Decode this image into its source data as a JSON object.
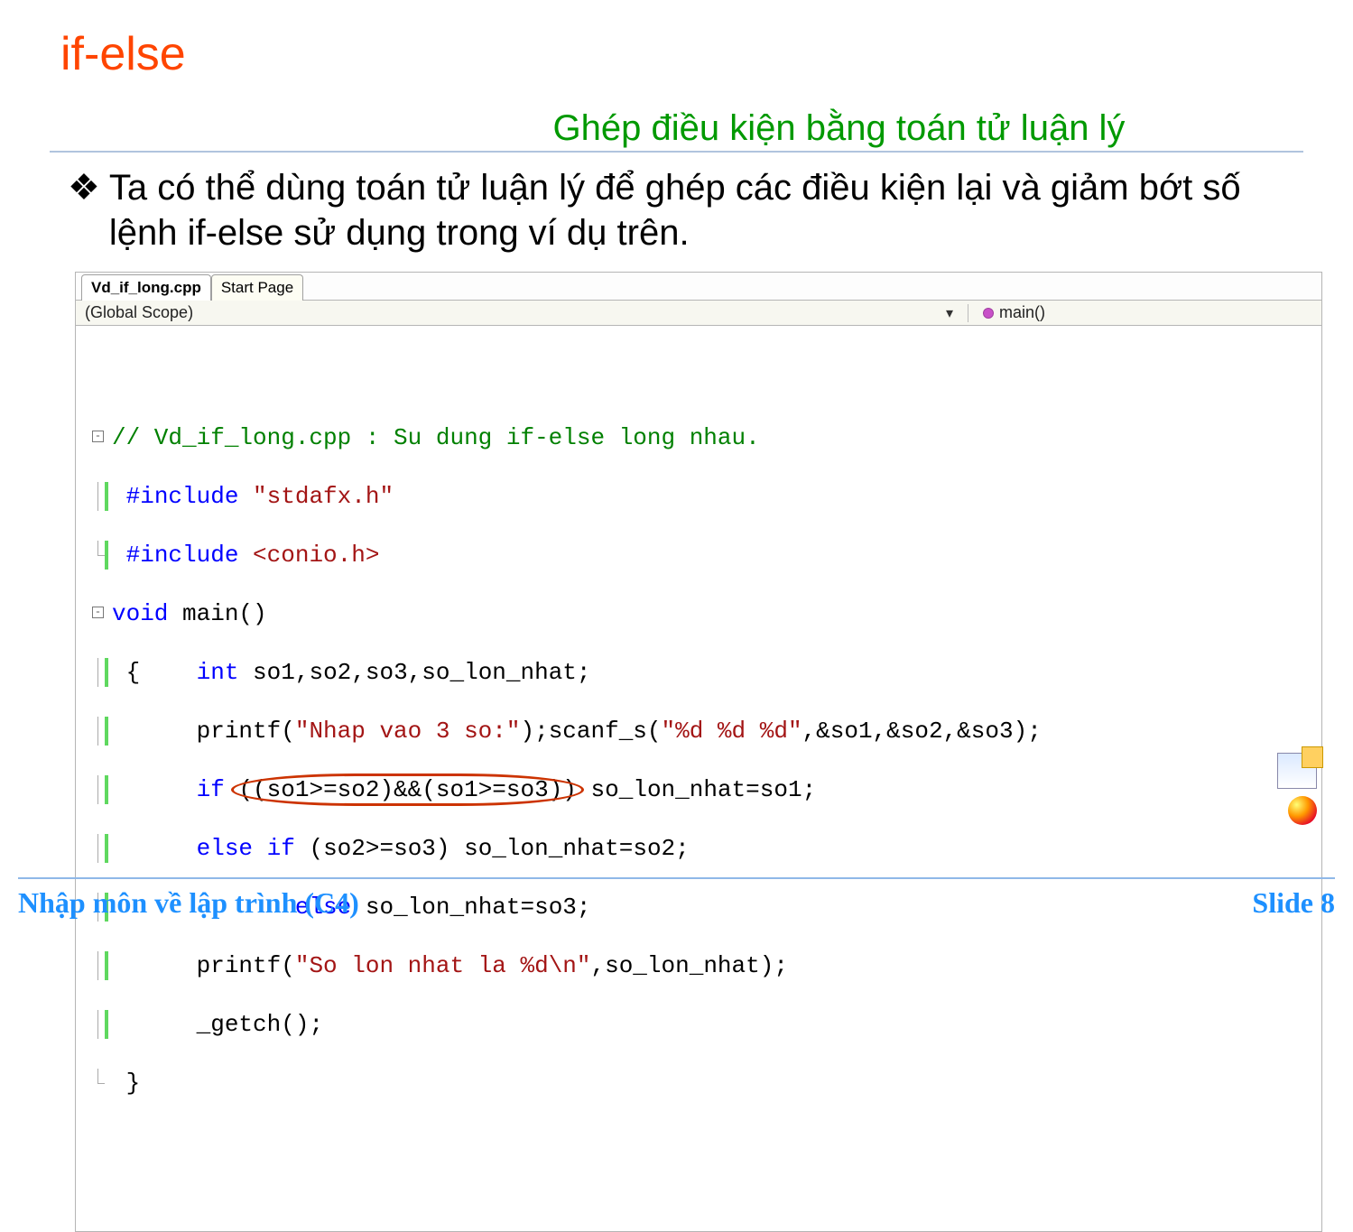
{
  "title": "if-else",
  "subtitle": "Ghép điều kiện bằng toán tử luận lý",
  "bullet_text": "Ta có thể dùng toán tử luận lý để ghép các điều kiện lại và giảm bớt số lệnh if-else sử dụng trong ví dụ trên.",
  "ide": {
    "tabs": {
      "active": "Vd_if_long.cpp",
      "inactive": "Start Page"
    },
    "scope_left": "(Global Scope)",
    "scope_right": "main()",
    "code": {
      "l1_comment": "// Vd_if_long.cpp : Su dung if-else long nhau.",
      "l2_a": "#include ",
      "l2_b": "\"stdafx.h\"",
      "l3_a": "#include ",
      "l3_b": "<conio.h>",
      "l4_a": "void",
      "l4_b": " main()",
      "l5": "{",
      "l5b_kw": "int",
      "l5b_rest": " so1,so2,so3,so_lon_nhat;",
      "l6_a": "printf(",
      "l6_b": "\"Nhap vao 3 so:\"",
      "l6_c": ");scanf_s(",
      "l6_d": "\"%d %d %d\"",
      "l6_e": ",&so1,&so2,&so3);",
      "l7_a": "if",
      "l7_cond": "((so1>=so2)&&(so1>=so3))",
      "l7_c": "so_lon_nhat=so1;",
      "l8_a": "else",
      "l8_b": " ",
      "l8_c": "if",
      "l8_d": " (so2>=so3) so_lon_nhat=so2;",
      "l9_a": "else",
      "l9_b": " so_lon_nhat=so3;",
      "l10_a": "printf(",
      "l10_b": "\"So lon nhat la %d\\n\"",
      "l10_c": ",so_lon_nhat);",
      "l11": "_getch();",
      "l12": "}"
    }
  },
  "footer_left": "Nhập môn về lập trình (C4)",
  "footer_right": "Slide 8"
}
